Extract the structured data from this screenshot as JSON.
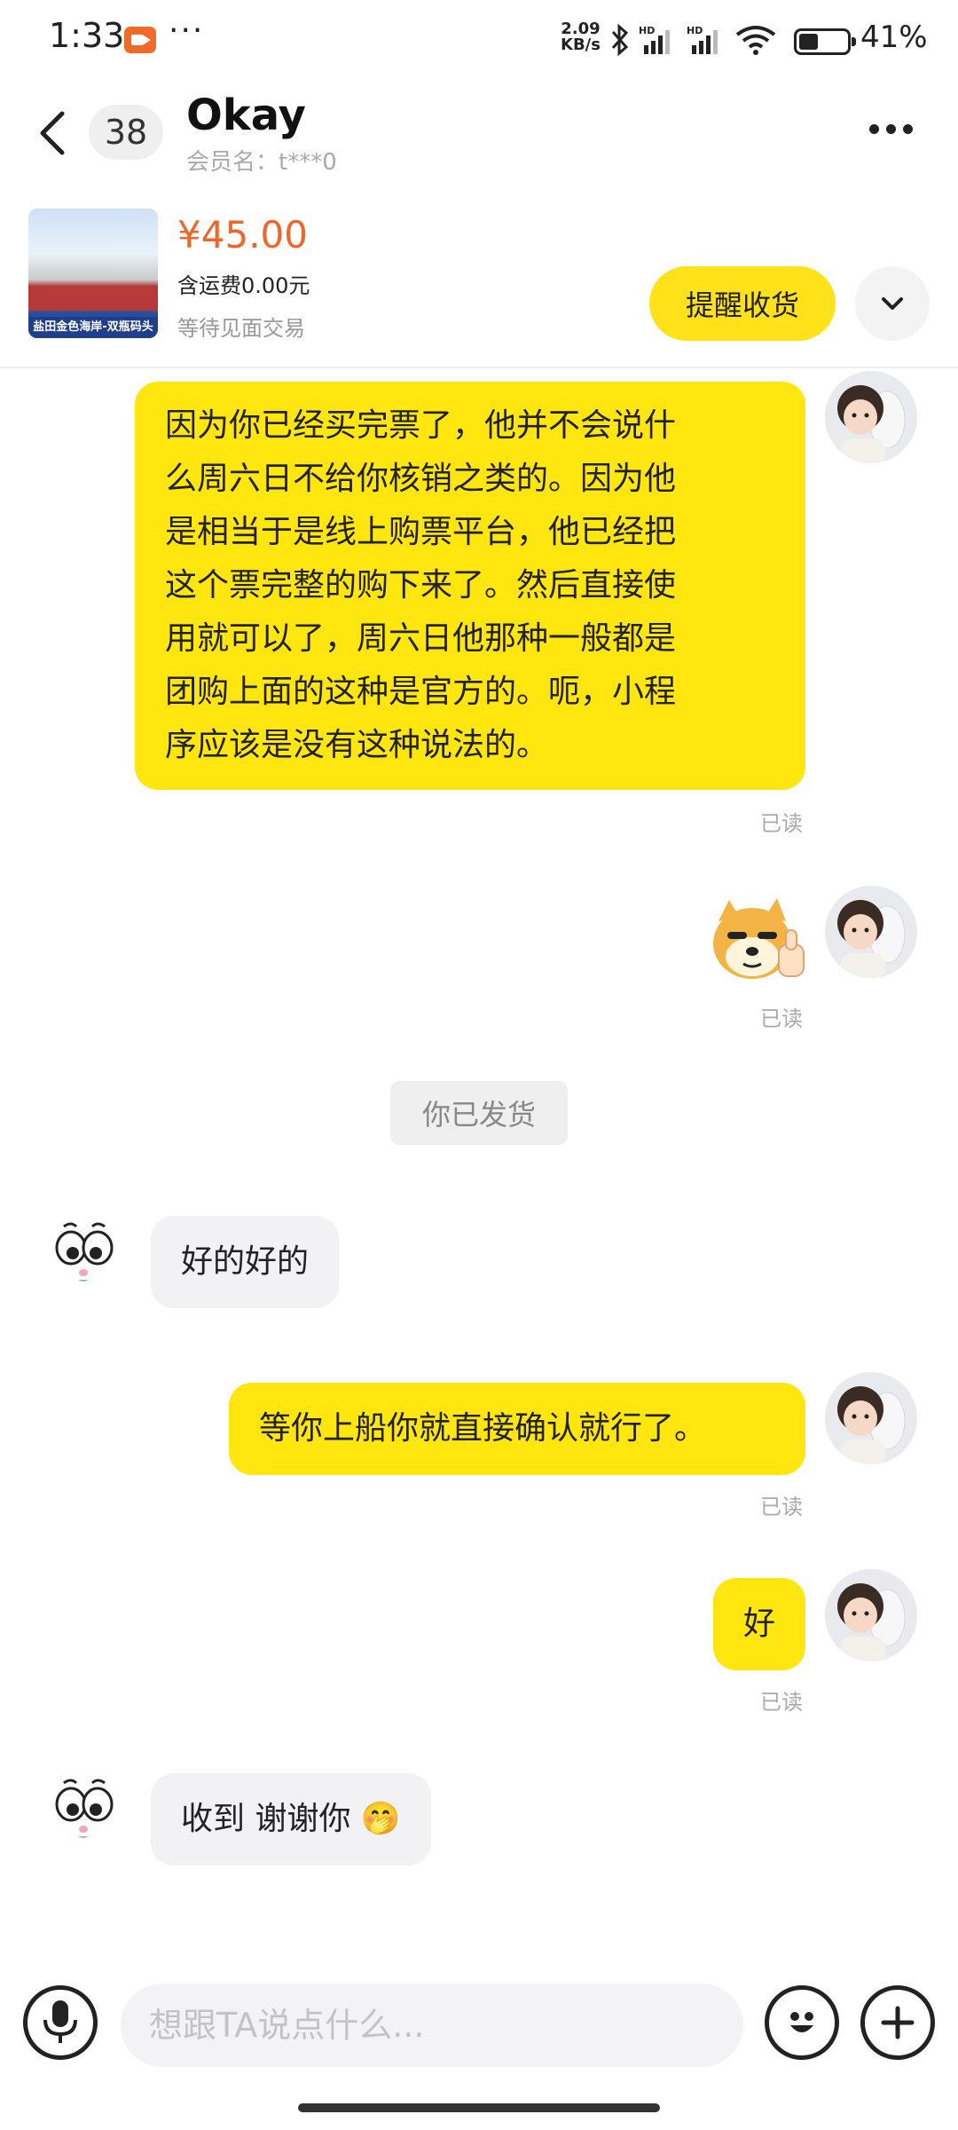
{
  "status_bar": {
    "time": "1:33",
    "dots": "···",
    "net_speed_value": "2.09",
    "net_speed_unit": "KB/s",
    "network_labels": [
      "HD",
      "HD"
    ],
    "battery_level": 41,
    "battery_text": "41%"
  },
  "header": {
    "back_icon": "chevron-left-icon",
    "unread_count": "38",
    "title": "Okay",
    "subtitle": "会员名：t***0",
    "more_icon": "more-horizontal-icon"
  },
  "product": {
    "thumbnail_caption": "盐田金色海岸-双瓶码头",
    "price": "¥45.00",
    "shipping": "含运费0.00元",
    "status": "等待见面交易",
    "remind_button": "提醒收货",
    "expand_icon": "chevron-down-icon"
  },
  "messages": {
    "m1": {
      "sender": "me",
      "lines": [
        "因为你已经买完票了，他并不会说什",
        "么周六日不给你核销之类的。因为他",
        "是相当于是线上购票平台，他已经把",
        "这个票完整的购下来了。然后直接使",
        "用就可以了，周六日他那种一般都是",
        "团购上面的这种是官方的。呃，小程",
        "序应该是没有这种说法的。"
      ],
      "read": "已读"
    },
    "m2": {
      "sender": "me",
      "sticker": "doge-thumbs-up-sticker",
      "read": "已读"
    },
    "system": "你已发货",
    "m3": {
      "sender": "other",
      "text": "好的好的"
    },
    "m4": {
      "sender": "me",
      "text": "等你上船你就直接确认就行了。",
      "read": "已读"
    },
    "m5": {
      "sender": "me",
      "text": "好",
      "read": "已读"
    },
    "m6": {
      "sender": "other",
      "text": "收到 谢谢你",
      "emoji": "🤭"
    }
  },
  "input_bar": {
    "voice_icon": "microphone-icon",
    "placeholder": "想跟TA说点什么...",
    "emoji_icon": "smiley-icon",
    "plus_icon": "plus-icon"
  },
  "colors": {
    "my_bubble": "#ffe60f",
    "other_bubble": "#f2f2f4",
    "price": "#f0652a",
    "remind_button": "#ffe21a"
  }
}
